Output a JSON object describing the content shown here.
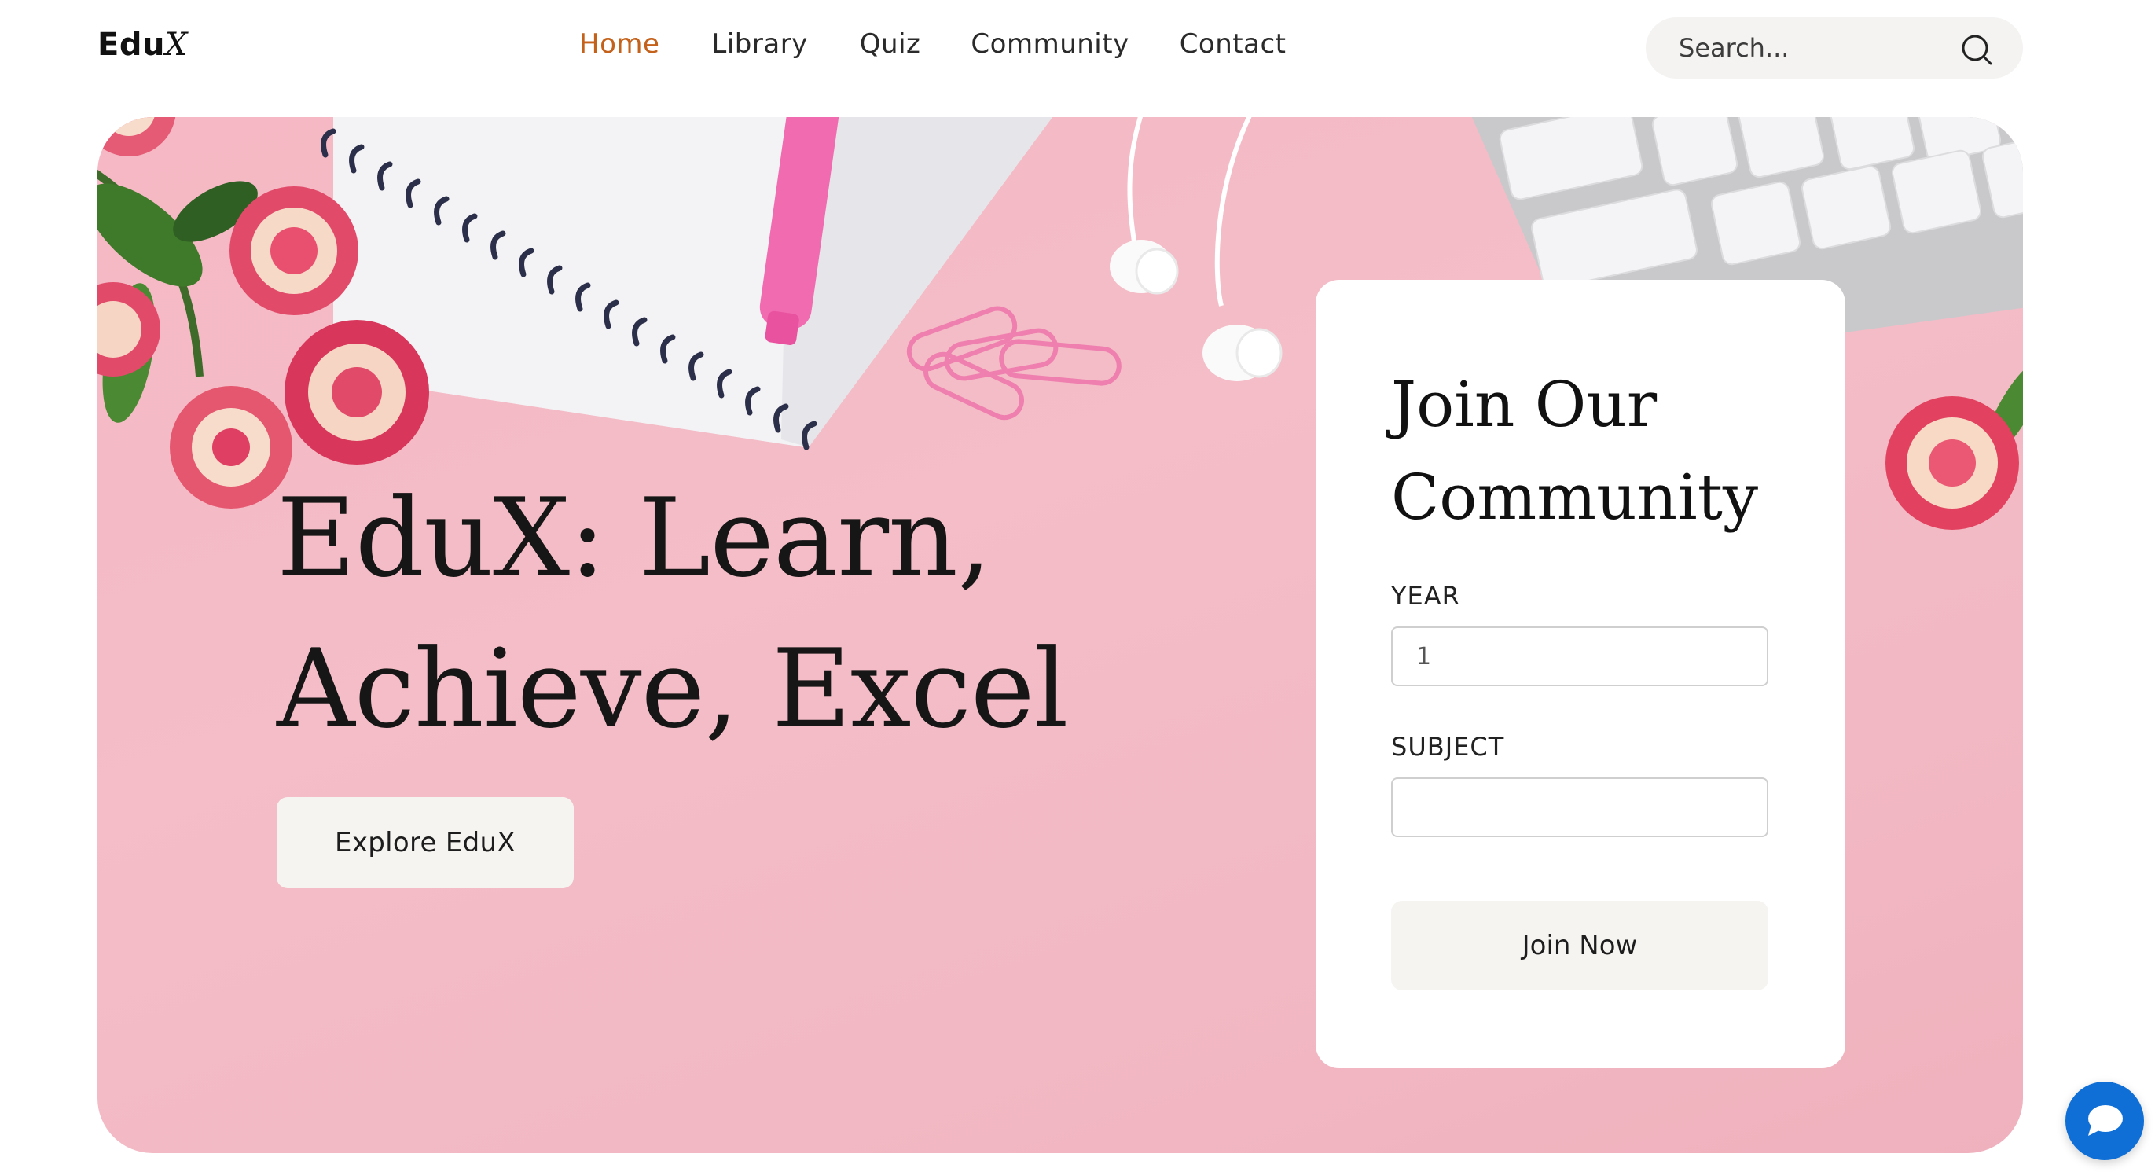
{
  "brand": {
    "name": "Edu",
    "name_suffix": "X"
  },
  "nav": {
    "items": [
      {
        "label": "Home",
        "active": true
      },
      {
        "label": "Library",
        "active": false
      },
      {
        "label": "Quiz",
        "active": false
      },
      {
        "label": "Community",
        "active": false
      },
      {
        "label": "Contact",
        "active": false
      }
    ],
    "active_color": "#c4621c"
  },
  "search": {
    "placeholder": "Search...",
    "icon": "search-icon"
  },
  "hero": {
    "title_line1": "EduX: Learn,",
    "title_line2": "Achieve, Excel",
    "cta_label": "Explore EduX",
    "background_color": "#f4bdc7"
  },
  "join_form": {
    "title_line1": "Join Our",
    "title_line2": "Community",
    "year_label": "YEAR",
    "year_value": "1",
    "subject_label": "SUBJECT",
    "subject_value": "",
    "submit_label": "Join Now"
  },
  "chat": {
    "icon": "chat-bubble-icon",
    "color": "#0f6fd6"
  }
}
